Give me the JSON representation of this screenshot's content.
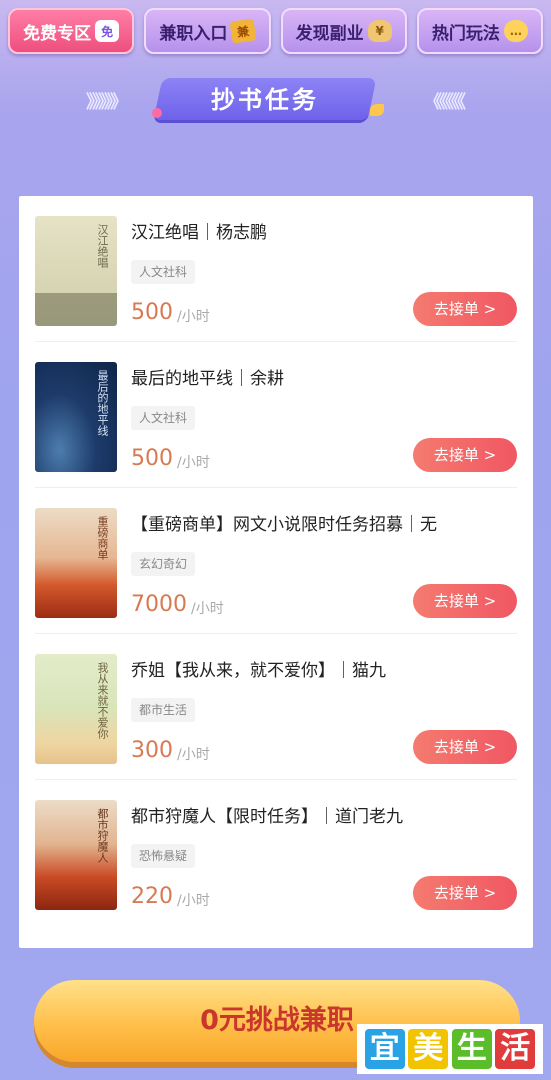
{
  "tabs": [
    {
      "label": "免费专区",
      "icon": "free-badge-icon",
      "icon_text": "免"
    },
    {
      "label": "兼职入口",
      "icon": "job-ticket-icon",
      "icon_text": "兼"
    },
    {
      "label": "发现副业",
      "icon": "money-bag-icon",
      "icon_text": "¥"
    },
    {
      "label": "热门玩法",
      "icon": "chat-bubble-icon",
      "icon_text": "…"
    }
  ],
  "section_title": "抄书任务",
  "title_arrows": {
    "left": "》》》》》",
    "right": "《《《《《"
  },
  "tasks": [
    {
      "title": "汉江绝唱｜杨志鹏",
      "tag": "人文社科",
      "price": "500",
      "unit": "/小时",
      "button": "去接单 >",
      "cover_text": "汉江绝唱"
    },
    {
      "title": "最后的地平线｜余耕",
      "tag": "人文社科",
      "price": "500",
      "unit": "/小时",
      "button": "去接单 >",
      "cover_text": "最后的地平线"
    },
    {
      "title": "【重磅商单】网文小说限时任务招募｜无",
      "tag": "玄幻奇幻",
      "price": "7000",
      "unit": "/小时",
      "button": "去接单 >",
      "cover_text": "重磅商单"
    },
    {
      "title": "乔姐【我从来，就不爱你】｜猫九",
      "tag": "都市生活",
      "price": "300",
      "unit": "/小时",
      "button": "去接单 >",
      "cover_text": "我从来就不爱你"
    },
    {
      "title": "都市狩魔人【限时任务】｜道门老九",
      "tag": "恐怖悬疑",
      "price": "220",
      "unit": "/小时",
      "button": "去接单 >",
      "cover_text": "都市狩魔人"
    }
  ],
  "cta_label": "0元挑战兼职",
  "watermark": [
    "宜",
    "美",
    "生",
    "活"
  ],
  "colors": {
    "accent": "#f05763",
    "price": "#d77a52",
    "background": "#a2a8ef",
    "cta": "#ffbf4a"
  }
}
